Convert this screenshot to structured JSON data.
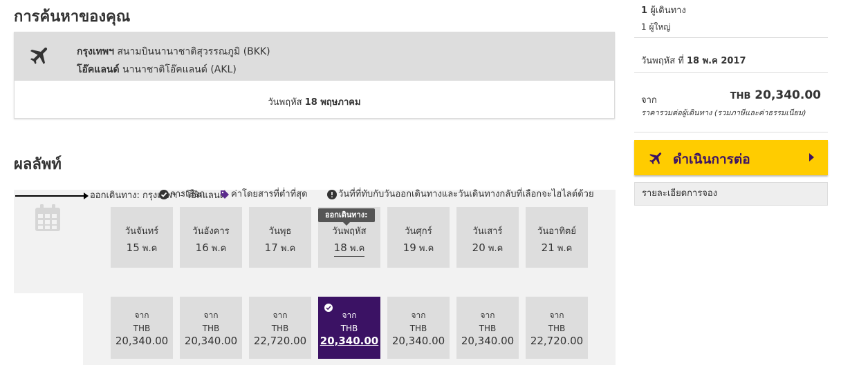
{
  "search": {
    "title": "การค้นหาของคุณ",
    "origin_code_name": "กรุงเทพฯ",
    "origin_airport": "สนามบินนานาชาติสุวรรณภูมิ (BKK)",
    "destination_code_name": "โอ๊คแลนด์",
    "destination_airport": "นานาชาติโอ๊คแลนด์ (AKL)",
    "date_prefix": "วันพฤหัส",
    "date_main": "18 พฤษภาคม",
    "plane_icon": "plane-icon"
  },
  "results": {
    "title": "ผลลัพท์",
    "direction_label": "ออกเดินทาง: กรุงเทพฯ - โอ๊คแลนด์",
    "legend": {
      "selected_label": "การเลือก",
      "lowest_label": "ค่าโดยสารที่ต่ำที่สุด",
      "notice_label": "วันที่ที่ทับกับวันออกเดินทางและวันเดินทางกลับที่เลือกจะไฮไลต์ด้วย"
    },
    "tooltip": "ออกเดินทาง:",
    "days": [
      {
        "name": "วันจันทร์",
        "num": "15",
        "month": "พ.ค"
      },
      {
        "name": "วันอังคาร",
        "num": "16",
        "month": "พ.ค"
      },
      {
        "name": "วันพุธ",
        "num": "17",
        "month": "พ.ค"
      },
      {
        "name": "วันพฤหัส",
        "num": "18",
        "month": "พ.ค"
      },
      {
        "name": "วันศุกร์",
        "num": "19",
        "month": "พ.ค"
      },
      {
        "name": "วันเสาร์",
        "num": "20",
        "month": "พ.ค"
      },
      {
        "name": "วันอาทิตย์",
        "num": "21",
        "month": "พ.ค"
      }
    ],
    "prices": [
      {
        "from": "จาก",
        "currency": "THB",
        "value": "20,340.00"
      },
      {
        "from": "จาก",
        "currency": "THB",
        "value": "20,340.00"
      },
      {
        "from": "จาก",
        "currency": "THB",
        "value": "22,720.00"
      },
      {
        "from": "จาก",
        "currency": "THB",
        "value": "20,340.00"
      },
      {
        "from": "จาก",
        "currency": "THB",
        "value": "20,340.00"
      },
      {
        "from": "จาก",
        "currency": "THB",
        "value": "20,340.00"
      },
      {
        "from": "จาก",
        "currency": "THB",
        "value": "22,720.00"
      }
    ],
    "selected_index": 3
  },
  "sidebar": {
    "passenger_count": "1",
    "passenger_label": "ผู้เดินทาง",
    "adult_label": "1 ผู้ใหญ่",
    "date_prefix": "วันพฤหัส ที่",
    "date_main": "18 พ.ค 2017",
    "from_label": "จาก",
    "currency": "THB",
    "price": "20,340.00",
    "price_note": "ราคารวมต่อผู้เดินทาง (รวมภาษีและค่าธรรมเนียม)",
    "continue_label": "ดำเนินการต่อ",
    "details_label": "รายละเอียดการจอง"
  },
  "colors": {
    "brand_purple": "#3b1264",
    "accent_yellow": "#ffcc00",
    "card_gray": "#dddddd"
  }
}
